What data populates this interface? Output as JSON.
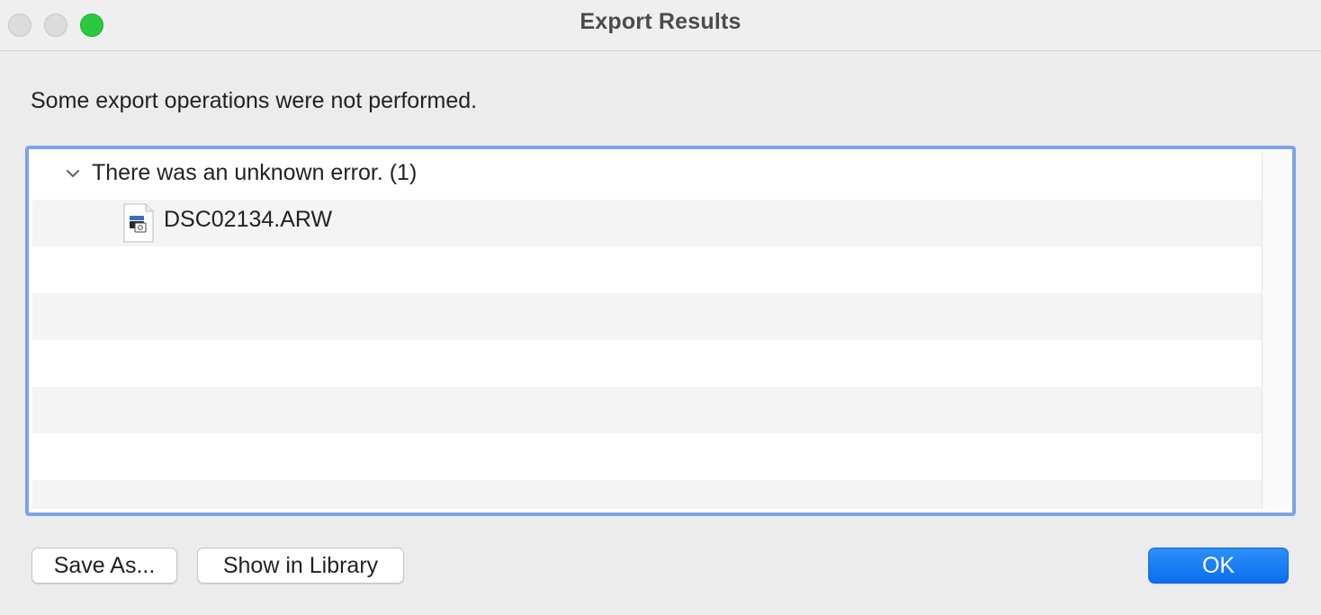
{
  "window": {
    "title": "Export Results"
  },
  "message": "Some export operations were not performed.",
  "results": {
    "groups": [
      {
        "label": "There was an unknown error. (1)",
        "expanded": true,
        "files": [
          {
            "name": "DSC02134.ARW",
            "icon": "raw-image-file-icon"
          }
        ]
      }
    ]
  },
  "buttons": {
    "save_as": "Save As...",
    "show_in_library": "Show in Library",
    "ok": "OK"
  },
  "colors": {
    "focus_ring": "#7ea3ea",
    "ok_button": "#0a6ff0",
    "zoom_button": "#29c940"
  }
}
